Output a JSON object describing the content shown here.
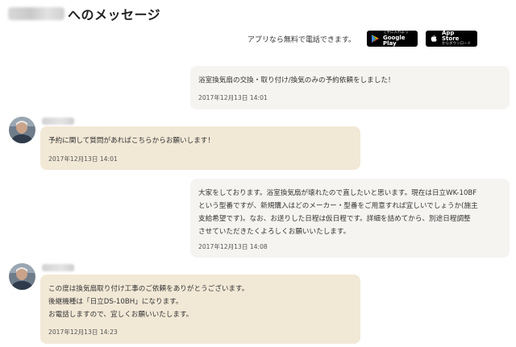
{
  "header": {
    "title_suffix": "へのメッセージ",
    "app_note": "アプリなら無料で電話できます。",
    "google_play": {
      "main": "Google Play",
      "sub": "で手に入れよう"
    },
    "app_store": {
      "main": "App Store",
      "sub": "からダウンロード"
    }
  },
  "messages": [
    {
      "side": "right",
      "text": "浴室換気扇の交換・取り付け/換気のみの予約依頼をしました！",
      "time": "2017年12月13日 14:01"
    },
    {
      "side": "left",
      "text": "予約に関して質問があればこちらからお願いします！",
      "time": "2017年12月13日 14:01"
    },
    {
      "side": "right",
      "text": "大家をしております。浴室換気扇が壊れたので直したいと思います。現在は日立WK-10BF\nという型番ですが、新規購入はどのメーカー・型番をご用意すれば宜しいでしょうか(施主\n支給希望です)。なお、お送りした日程は仮日程です。詳細を詰めてから、別途日程調整\nさせていただきたくよろしくお願いいたします。",
      "time": "2017年12月13日 14:08"
    },
    {
      "side": "left",
      "text": "この度は換気扇取り付け工事のご依頼をありがとうございます。\n後継機種は「日立DS-10BH」になります。\nお電話しますので、宜しくお願いいたします。",
      "time": "2017年12月13日 14:23"
    }
  ]
}
